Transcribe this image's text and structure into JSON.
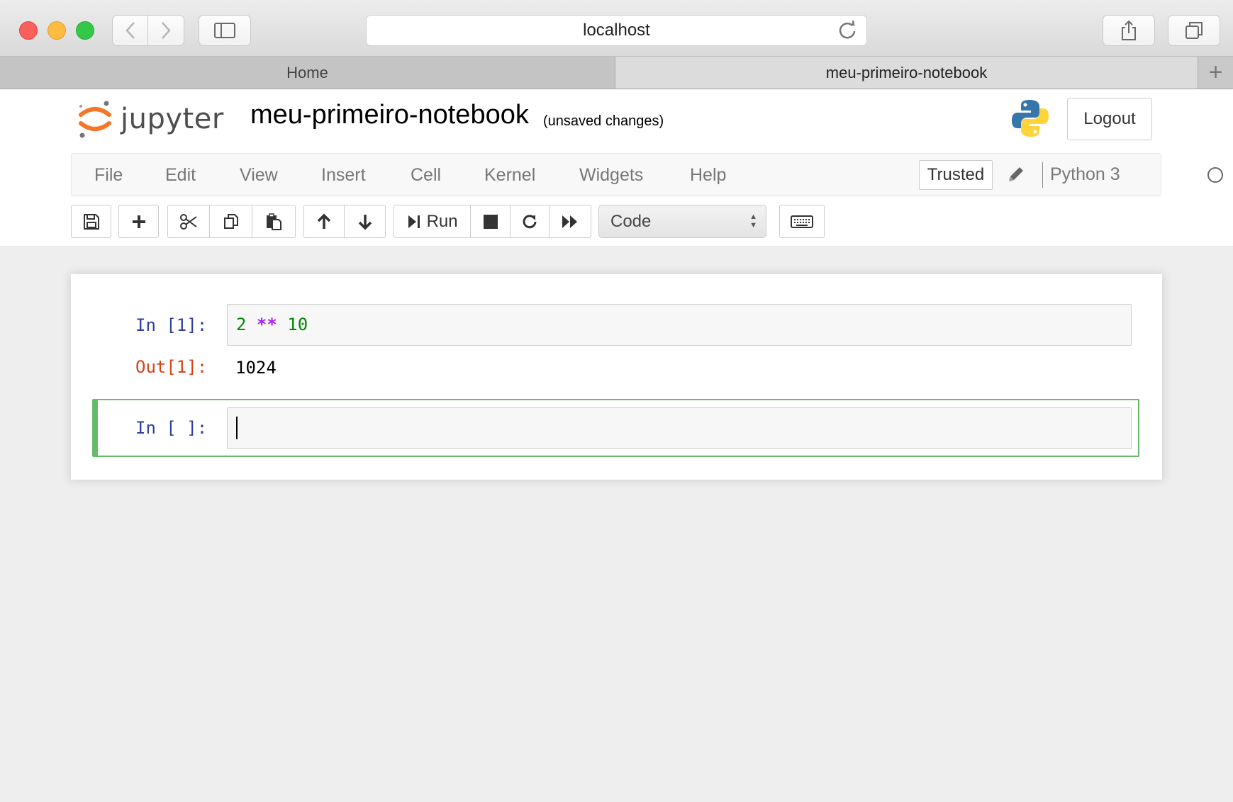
{
  "browser": {
    "url": "localhost",
    "tabs": [
      {
        "label": "Home"
      },
      {
        "label": "meu-primeiro-notebook"
      }
    ],
    "new_tab_label": "+"
  },
  "header": {
    "logo_text": "jupyter",
    "notebook_name": "meu-primeiro-notebook",
    "save_status": "(unsaved changes)",
    "logout_label": "Logout"
  },
  "menu": {
    "items": [
      "File",
      "Edit",
      "View",
      "Insert",
      "Cell",
      "Kernel",
      "Widgets",
      "Help"
    ],
    "trusted_label": "Trusted",
    "kernel_name": "Python 3"
  },
  "toolbar": {
    "run_label": "Run",
    "cell_type": "Code"
  },
  "cells": [
    {
      "in_prompt": "In [1]:",
      "code_tokens": [
        "2",
        "**",
        "10"
      ],
      "out_prompt": "Out[1]:",
      "output": "1024"
    },
    {
      "in_prompt": "In [ ]:",
      "code": ""
    }
  ],
  "colors": {
    "in_prompt": "#303f9f",
    "out_prompt": "#d84315",
    "selected_cell_border": "#66bb6a",
    "jupyter_orange": "#f37726"
  }
}
